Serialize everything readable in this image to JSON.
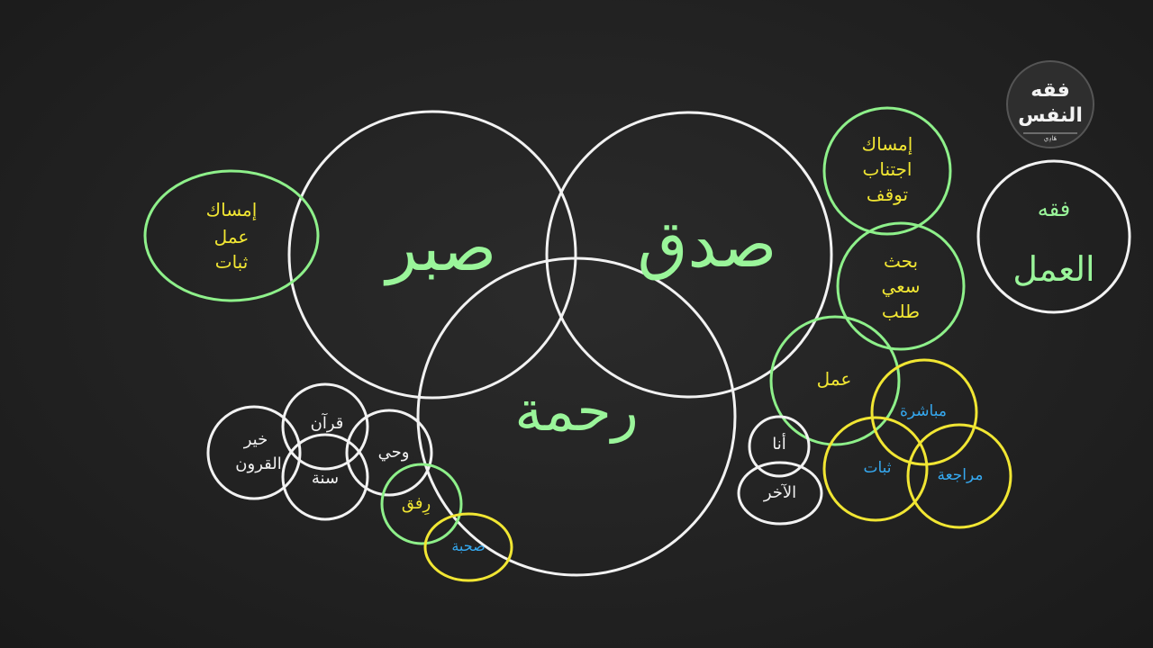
{
  "colors": {
    "white": "#f2f2f2",
    "green": "#8ef08a",
    "yellow": "#f1e633",
    "blue": "#35a8ef",
    "calligraphy_green": "#9af59a"
  },
  "main": {
    "sabr": "صبر",
    "sidq": "صدق",
    "rahma": "رحمة"
  },
  "sabr_group": [
    "إمساك",
    "عمل",
    "ثبات"
  ],
  "sidq_group_1": [
    "إمساك",
    "اجتناب",
    "توقف"
  ],
  "sidq_group_2": [
    "بحث",
    "سعي",
    "طلب"
  ],
  "amal": "عمل",
  "amal_cluster": {
    "mubashara": "مباشرة",
    "thabat": "ثبات",
    "muraja": "مراجعة"
  },
  "self_other": {
    "ana": "أنا",
    "akhar": "الآخر"
  },
  "sources": {
    "khayr": [
      "خير",
      "القرون"
    ],
    "quran": "قرآن",
    "sunna": "سنة",
    "wahy": "وحي"
  },
  "rifq": "رِفق",
  "suhba": "صحبة",
  "logo": {
    "line1": "فقه",
    "line2": "النفس",
    "small": "هَادِي"
  },
  "fiqh_amal": {
    "line1": "فقه",
    "line2": "العمل"
  }
}
